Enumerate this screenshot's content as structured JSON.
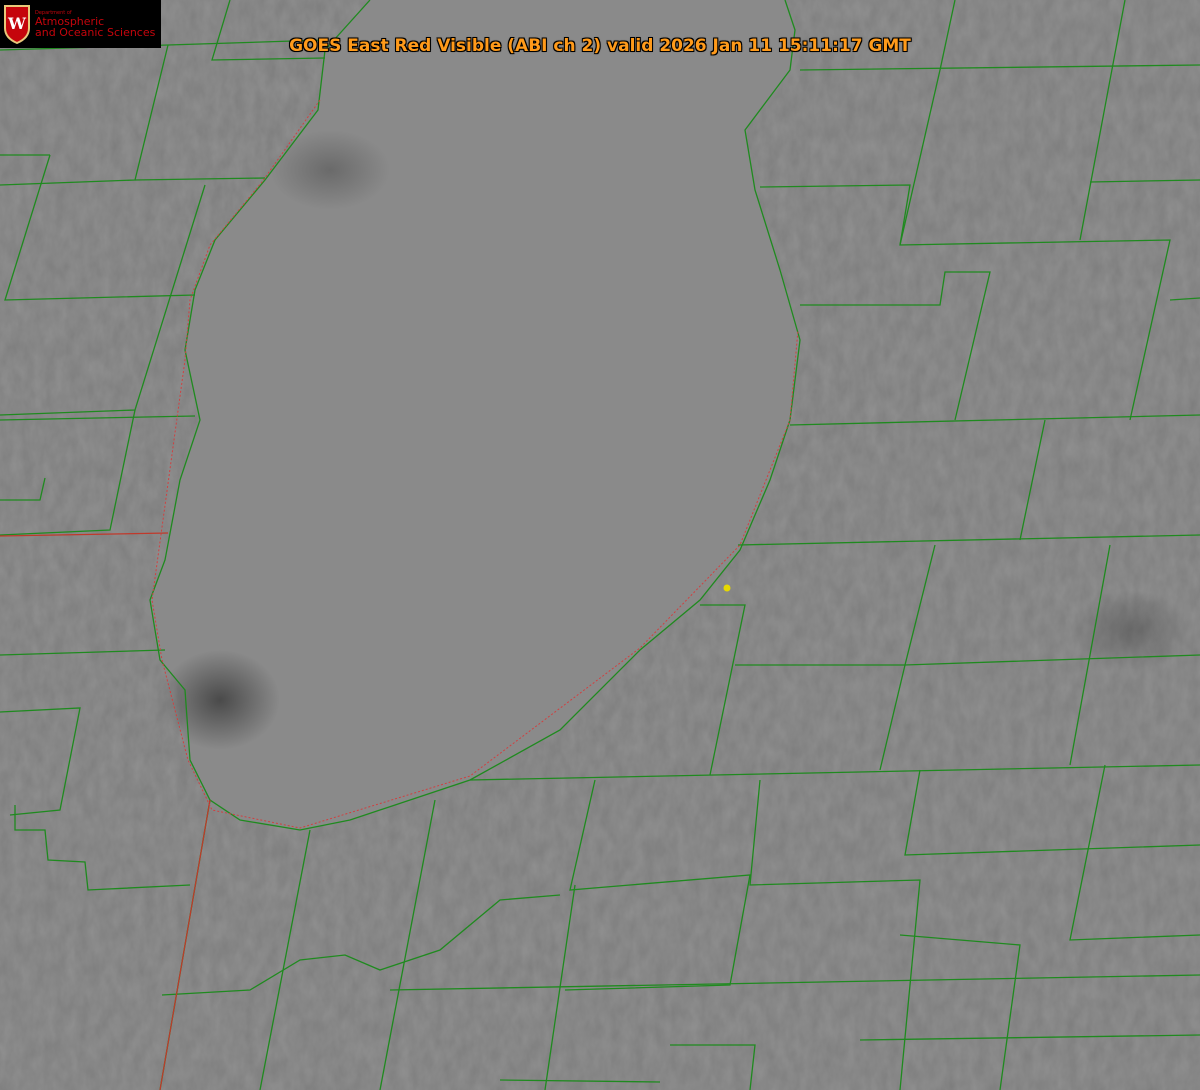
{
  "logo": {
    "department_of": "Department of",
    "line1": "Atmospheric",
    "line2": "and Oceanic Sciences",
    "crest_letter": "W"
  },
  "title": "GOES East Red Visible (ABI ch 2) valid 2026 Jan 11 15:11:17 GMT",
  "colors": {
    "title": "#ff9a1a",
    "county_lines": "#1f8a1f",
    "state_line": "#c0392b",
    "marker": "#e6d800",
    "logo_text": "#c5050c"
  }
}
